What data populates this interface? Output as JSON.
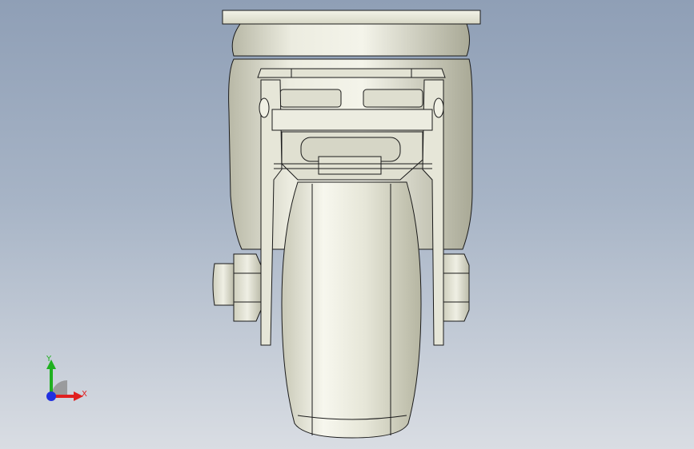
{
  "viewport": {
    "background_top": "#8f9fb6",
    "background_bottom": "#d9dde3",
    "model_fill": "#e9e9dc",
    "model_shade": "#c9c9b8",
    "edge_color": "#1a1a1a"
  },
  "triad": {
    "x_label": "X",
    "y_label": "Y",
    "x_color": "#e02020",
    "y_color": "#20b020",
    "z_color": "#2030e0"
  }
}
